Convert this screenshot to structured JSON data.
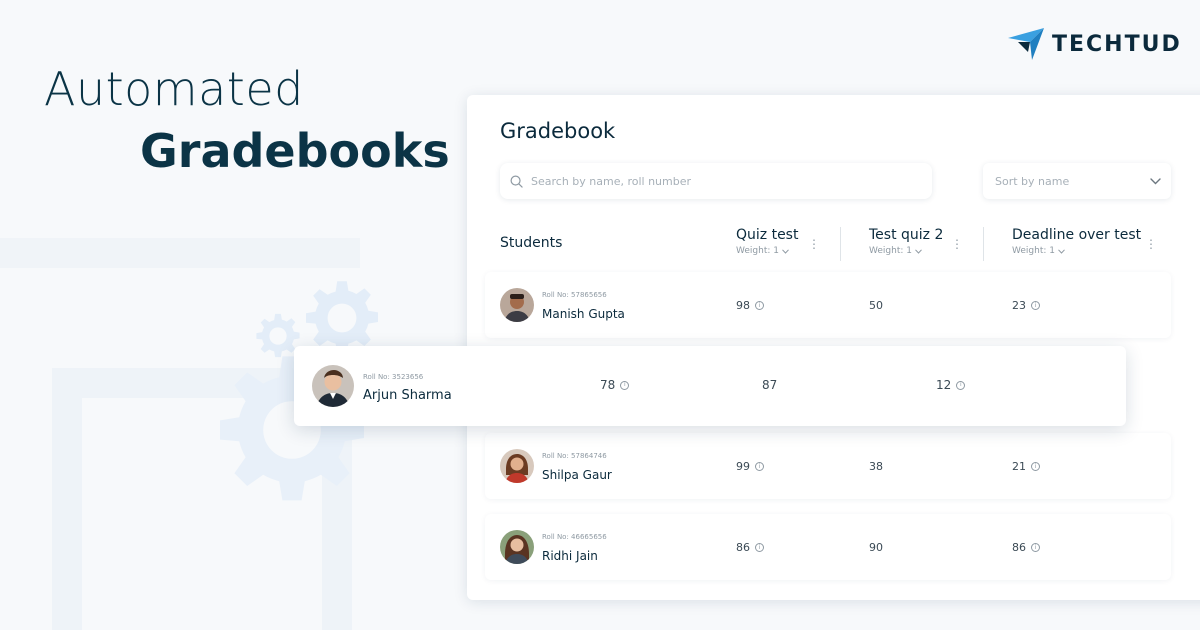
{
  "hero": {
    "line1": "Automated",
    "line2": "Gradebooks"
  },
  "logo": {
    "text": "TECHTUD",
    "colors": {
      "light": "#3aa0e0",
      "dark": "#0b2a3c"
    }
  },
  "gradebook": {
    "title": "Gradebook",
    "search": {
      "placeholder": "Search by name, roll number"
    },
    "sort": {
      "value": "Sort by name"
    },
    "columns": {
      "students": "Students",
      "tests": [
        {
          "title": "Quiz test",
          "weight": "Weight: 1"
        },
        {
          "title": "Test quiz 2",
          "weight": "Weight: 1"
        },
        {
          "title": "Deadline over test",
          "weight": "Weight: 1"
        }
      ]
    },
    "rows": [
      {
        "roll": "Roll No: 57865656",
        "name": "Manish Gupta",
        "scores": [
          "98",
          "50",
          "23"
        ]
      },
      {
        "roll": "Roll No: 3523656",
        "name": "Arjun Sharma",
        "scores": [
          "78",
          "87",
          "12"
        ]
      },
      {
        "roll": "Roll No: 57864746",
        "name": "Shilpa Gaur",
        "scores": [
          "99",
          "38",
          "21"
        ]
      },
      {
        "roll": "Roll No: 46665656",
        "name": "Ridhi Jain",
        "scores": [
          "86",
          "90",
          "86"
        ]
      }
    ]
  },
  "icons": {
    "search": "search-icon",
    "chevron": "chevron-down-icon",
    "kebab": "kebab-menu-icon",
    "info": "info-icon",
    "gear": "gear-icon"
  },
  "colors": {
    "accent": "#0b3446",
    "muted": "#8f9aa3",
    "gear": "#e3edf8"
  }
}
